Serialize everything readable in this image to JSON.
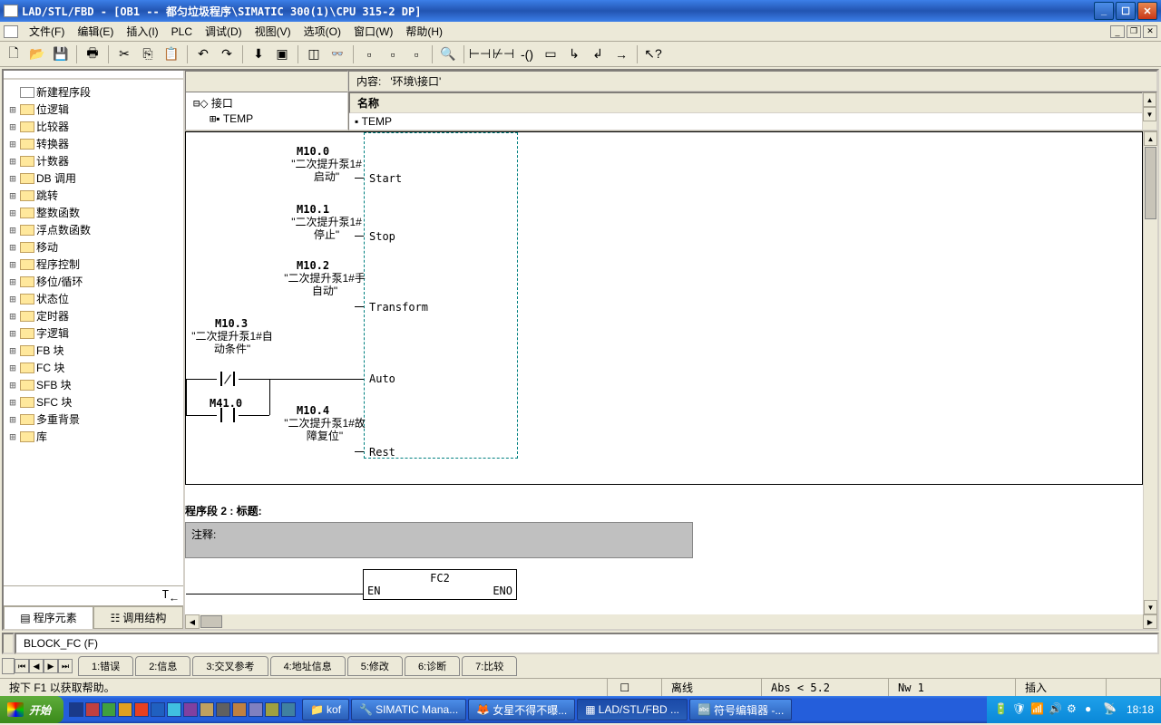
{
  "title": "LAD/STL/FBD  - [OB1 -- 都匀垃圾程序\\SIMATIC 300(1)\\CPU 315-2 DP]",
  "menus": {
    "file": "文件(F)",
    "edit": "编辑(E)",
    "insert": "插入(I)",
    "plc": "PLC",
    "debug": "调试(D)",
    "view": "视图(V)",
    "options": "选项(O)",
    "window": "窗口(W)",
    "help": "帮助(H)"
  },
  "tree": {
    "new_segment": "新建程序段",
    "items": [
      "位逻辑",
      "比较器",
      "转换器",
      "计数器",
      "DB 调用",
      "跳转",
      "整数函数",
      "浮点数函数",
      "移动",
      "程序控制",
      "移位/循环",
      "状态位",
      "定时器",
      "字逻辑",
      "FB 块",
      "FC 块",
      "SFB 块",
      "SFC 块",
      "多重背景",
      "库"
    ]
  },
  "sidebar_tabs": {
    "elements": "程序元素",
    "call": "调用结构"
  },
  "content_header": {
    "content_label": "内容:",
    "content_path": "'环境\\接口'",
    "name_label": "名称",
    "interface": "接口",
    "temp": "TEMP",
    "temp2": "TEMP"
  },
  "chart_data": {
    "type": "ladder-fbd",
    "block_pins": [
      {
        "mem": "M10.0",
        "desc": "\"二次提升泵1#启动\"",
        "pin": "Start"
      },
      {
        "mem": "M10.1",
        "desc": "\"二次提升泵1#停止\"",
        "pin": "Stop"
      },
      {
        "mem": "M10.2",
        "desc": "\"二次提升泵1#手自动\"",
        "pin": "Transform"
      },
      {
        "mem": "M10.3",
        "desc": "\"二次提升泵1#自动条件\"",
        "pin": "Auto",
        "contact": "negated"
      },
      {
        "mem": "M10.4",
        "desc": "\"二次提升泵1#故障复位\"",
        "pin": "Rest"
      }
    ],
    "parallel_contact": {
      "mem": "M41.0",
      "type": "open"
    }
  },
  "seg2": {
    "title": "程序段  2 : 标题:",
    "comment": "注释:",
    "fc": {
      "name": "FC2",
      "en": "EN",
      "eno": "ENO"
    }
  },
  "block_fc": "BLOCK_FC (F)",
  "msg_tabs": [
    "1:错误",
    "2:信息",
    "3:交叉参考",
    "4:地址信息",
    "5:修改",
    "6:诊断",
    "7:比较"
  ],
  "status": {
    "help": "按下 F1 以获取帮助。",
    "offline": "离线",
    "abs": "Abs < 5.2",
    "nw": "Nw 1",
    "insert": "插入"
  },
  "taskbar": {
    "start": "开始",
    "tasks": [
      "kof",
      "SIMATIC Mana...",
      "女星不得不曝...",
      "LAD/STL/FBD ...",
      "符号编辑器 -..."
    ],
    "clock": "18:18"
  }
}
